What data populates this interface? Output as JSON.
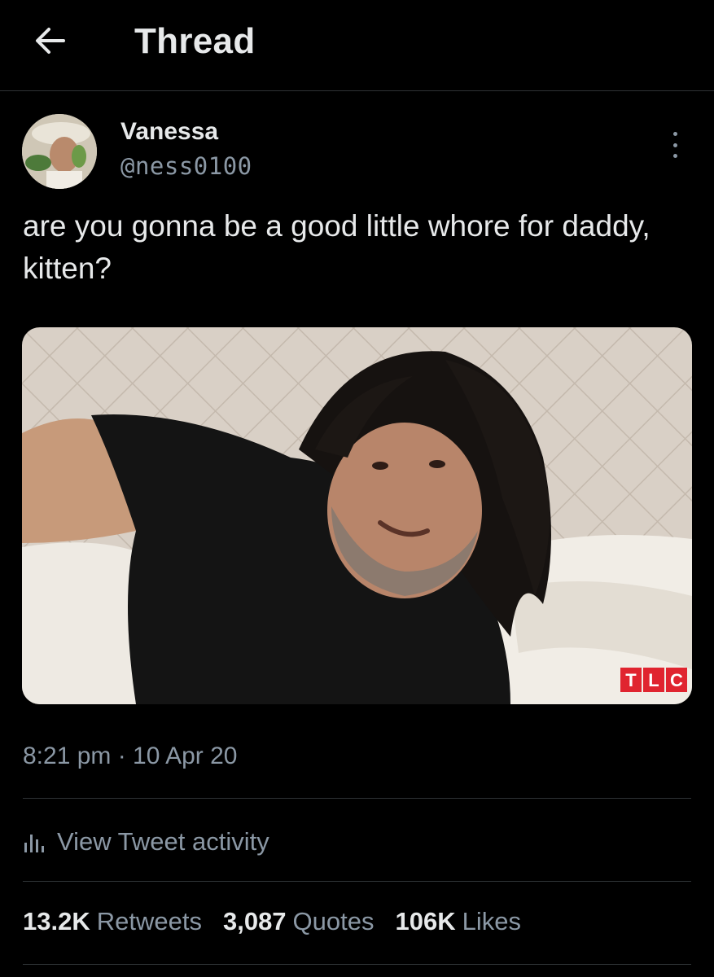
{
  "header": {
    "title": "Thread",
    "back_icon": "arrow-left-icon"
  },
  "tweet": {
    "display_name": "Vanessa",
    "handle": "@ness0100",
    "more_icon": "more-vertical-icon",
    "text": "are you gonna be a good little whore for daddy, kitten?",
    "media": {
      "watermark": "TLC",
      "watermark_color": "#e0242f"
    },
    "timestamp": "8:21 pm · 10 Apr 20"
  },
  "activity": {
    "label": "View Tweet activity",
    "icon": "bar-chart-icon"
  },
  "stats": [
    {
      "count": "13.2K",
      "label": "Retweets"
    },
    {
      "count": "3,087",
      "label": "Quotes"
    },
    {
      "count": "106K",
      "label": "Likes"
    }
  ],
  "colors": {
    "background": "#000000",
    "text": "#e7e9ea",
    "secondary": "#8b98a5",
    "divider": "#2f3336"
  }
}
